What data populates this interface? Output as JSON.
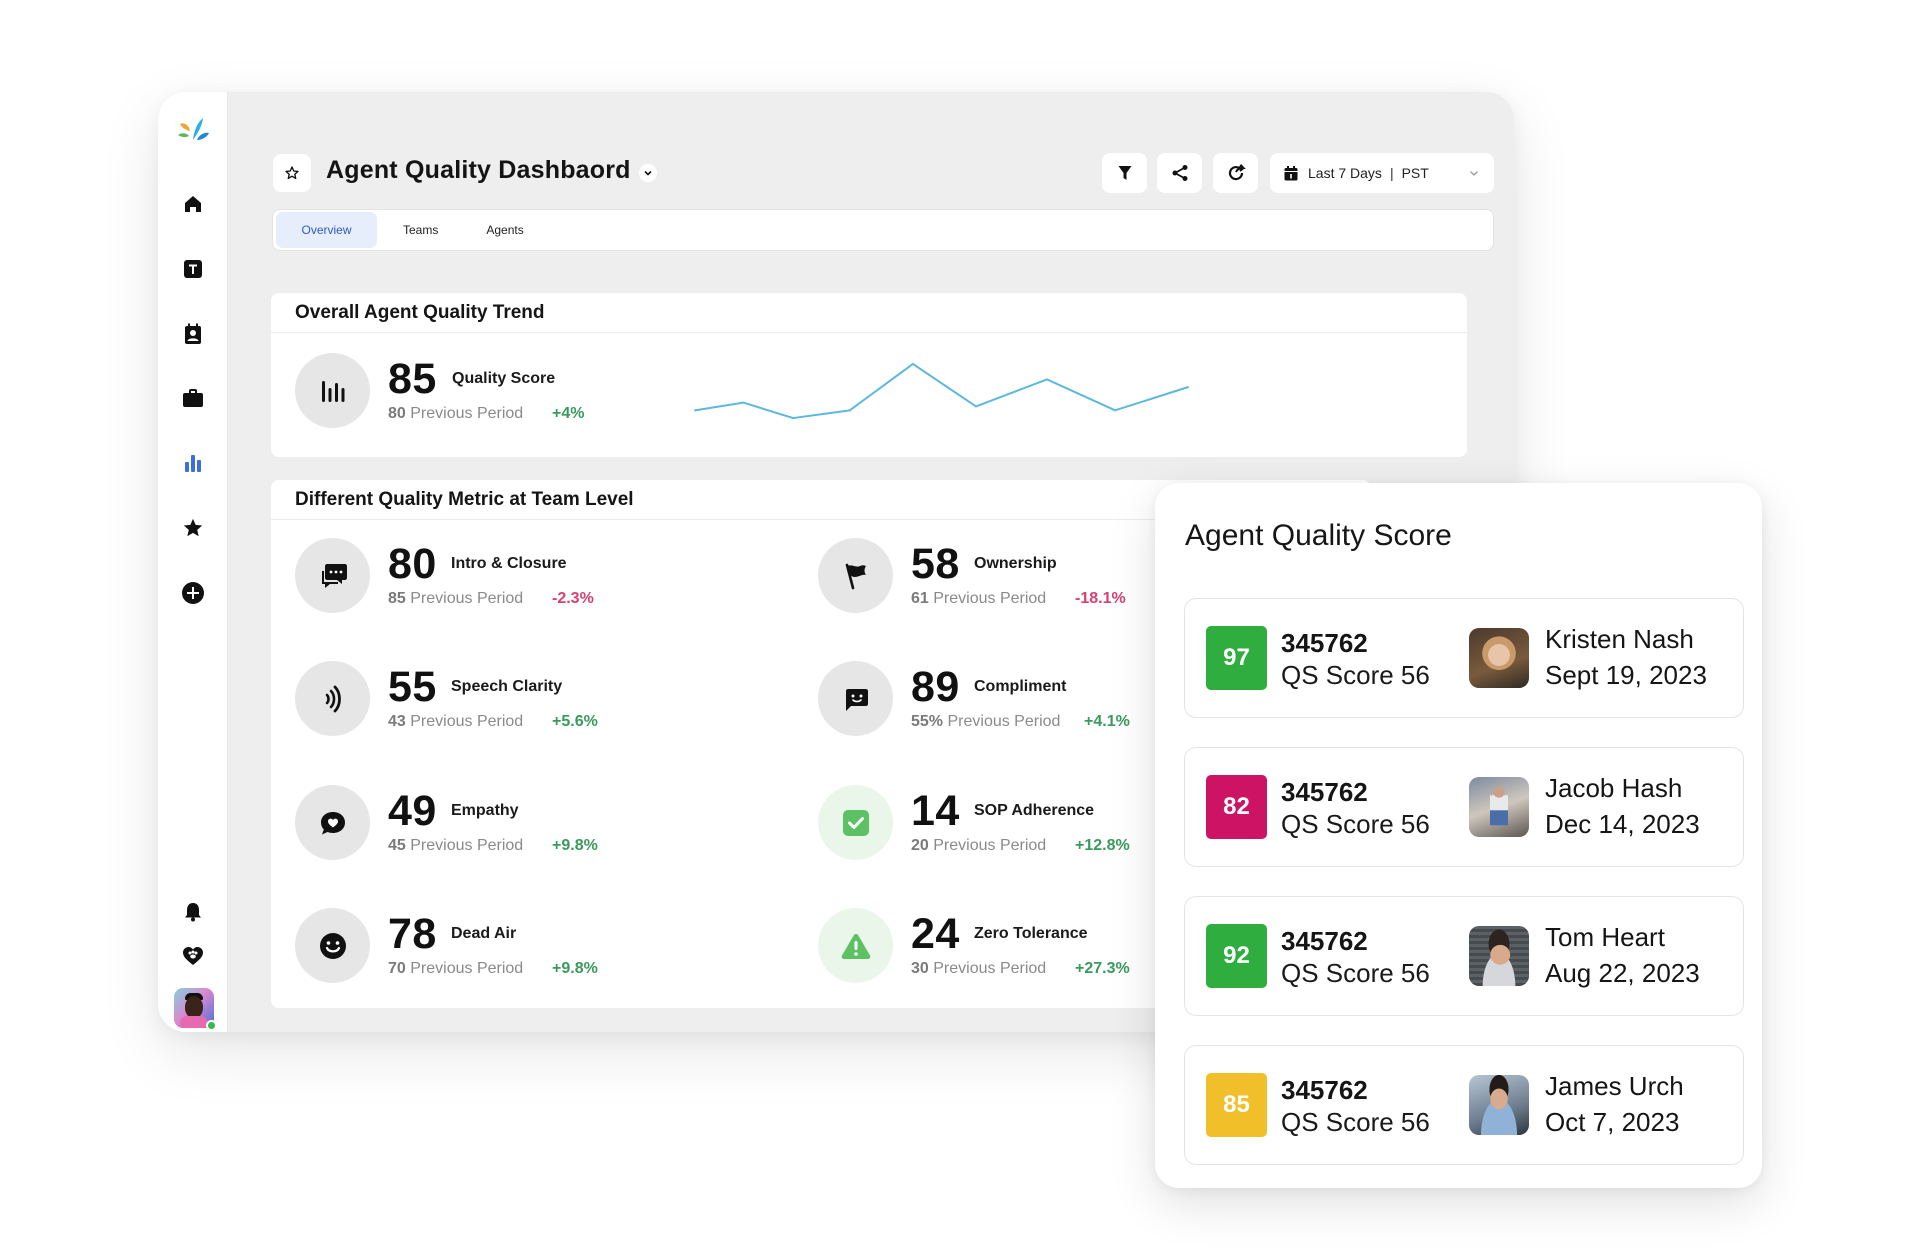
{
  "app": {
    "title": "Agent Quality Dashbaord",
    "brand_colors": {
      "logo": [
        "#f0a431",
        "#2bb0e6",
        "#5cb85c",
        "#1e88d6"
      ],
      "accent": "#3b6fe0"
    }
  },
  "sidebar": {
    "items": [
      {
        "name": "home",
        "icon": "home-icon",
        "active": false
      },
      {
        "name": "text",
        "icon": "text-t-icon",
        "active": false
      },
      {
        "name": "contacts",
        "icon": "contact-card-icon",
        "active": false
      },
      {
        "name": "cases",
        "icon": "briefcase-icon",
        "active": false
      },
      {
        "name": "analytics",
        "icon": "bar-chart-icon",
        "active": true
      },
      {
        "name": "favorites",
        "icon": "star-icon",
        "active": false
      },
      {
        "name": "add",
        "icon": "plus-circle-icon",
        "active": false
      }
    ],
    "bottom": [
      {
        "name": "notifications",
        "icon": "bell-icon"
      },
      {
        "name": "community",
        "icon": "heart-paw-icon"
      }
    ],
    "user": {
      "status": "online",
      "status_color": "#35b94a"
    }
  },
  "header": {
    "title": "Agent Quality Dashbaord",
    "toolbar": {
      "filter": "filter-icon",
      "share": "share-icon",
      "refresh": "refresh-icon"
    },
    "date_range": {
      "label": "Last 7 Days",
      "separator": "|",
      "timezone": "PST"
    }
  },
  "tabs": [
    {
      "label": "Overview",
      "active": true
    },
    {
      "label": "Teams",
      "active": false
    },
    {
      "label": "Agents",
      "active": false
    }
  ],
  "trend": {
    "title": "Overall Agent Quality Trend",
    "value": "85",
    "label": "Quality Score",
    "prev_value": "80",
    "prev_label": "Previous Period",
    "delta": "+4%",
    "delta_dir": "up",
    "line_color": "#5cb8dd"
  },
  "chart_data": {
    "type": "line",
    "title": "Overall Agent Quality Trend",
    "xlabel": "",
    "ylabel": "",
    "x": [
      1,
      2,
      3,
      4,
      5,
      6,
      7,
      8,
      9
    ],
    "series": [
      {
        "name": "Quality Score",
        "values": [
          80,
          82,
          78,
          80,
          92,
          81,
          88,
          80,
          86
        ]
      }
    ],
    "ylim": [
      70,
      100
    ],
    "grid": false,
    "legend": "none"
  },
  "metrics": {
    "title": "Different Quality Metric at Team Level",
    "prev_label": "Previous Period",
    "items": [
      {
        "value": "80",
        "label": "Intro & Closure",
        "prev": "85",
        "delta": "-2.3%",
        "dir": "down",
        "icon": "chat-bubbles-icon"
      },
      {
        "value": "58",
        "label": "Ownership",
        "prev": "61",
        "delta": "-18.1%",
        "dir": "down",
        "icon": "flag-icon"
      },
      {
        "value": "55",
        "label": "Speech Clarity",
        "prev": "43",
        "delta": "+5.6%",
        "dir": "up",
        "icon": "sound-waves-icon"
      },
      {
        "value": "89",
        "label": "Compliment",
        "prev": "55%",
        "delta": "+4.1%",
        "dir": "up",
        "icon": "smile-message-icon"
      },
      {
        "value": "49",
        "label": "Empathy",
        "prev": "45",
        "delta": "+9.8%",
        "dir": "up",
        "icon": "heart-message-icon"
      },
      {
        "value": "14",
        "label": "SOP Adherence",
        "prev": "20",
        "delta": "+12.8%",
        "dir": "up",
        "icon": "check-square-icon"
      },
      {
        "value": "78",
        "label": "Dead Air",
        "prev": "70",
        "delta": "+9.8%",
        "dir": "up",
        "icon": "smiley-face-icon"
      },
      {
        "value": "24",
        "label": "Zero Tolerance",
        "prev": "30",
        "delta": "+27.3%",
        "dir": "up",
        "icon": "warning-triangle-icon"
      }
    ]
  },
  "agent_quality": {
    "title": "Agent Quality Score",
    "rows": [
      {
        "score": "97",
        "color": "#2fae3f",
        "id": "345762",
        "qs": "QS Score 56",
        "name": "Kristen Nash",
        "date": "Sept 19, 2023"
      },
      {
        "score": "82",
        "color": "#cc1364",
        "id": "345762",
        "qs": "QS Score 56",
        "name": "Jacob Hash",
        "date": "Dec 14, 2023"
      },
      {
        "score": "92",
        "color": "#2fae3f",
        "id": "345762",
        "qs": "QS Score 56",
        "name": "Tom Heart",
        "date": "Aug 22, 2023"
      },
      {
        "score": "85",
        "color": "#f1bf2a",
        "id": "345762",
        "qs": "QS Score 56",
        "name": "James Urch",
        "date": "Oct 7, 2023"
      }
    ]
  }
}
